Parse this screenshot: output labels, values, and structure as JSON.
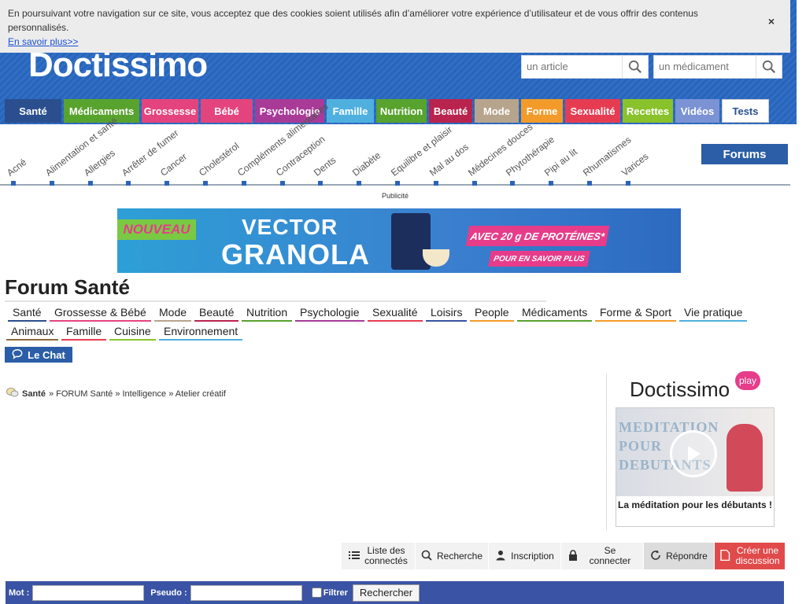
{
  "cookie": {
    "text": "En poursuivant votre navigation sur ce site, vous acceptez que des cookies soient utilisés afin d’améliorer votre expérience d’utilisateur et de vous offrir des contenus personnalisés.",
    "link": "En savoir plus>>",
    "close": "×"
  },
  "header": {
    "logo": "Doctissimo",
    "search_article_placeholder": "un article",
    "search_medicament_placeholder": "un médicament"
  },
  "mainnav": [
    {
      "label": "Santé",
      "color": "#2b4f8e",
      "width": 72
    },
    {
      "label": "Médicaments",
      "color": "#58a32e",
      "width": 96
    },
    {
      "label": "Grossesse",
      "color": "#e4447e",
      "width": 72
    },
    {
      "label": "Bébé",
      "color": "#e4447e",
      "width": 66
    },
    {
      "label": "Psychologie",
      "color": "#a83b98",
      "width": 88
    },
    {
      "label": "Famille",
      "color": "#4fb0e0",
      "width": 60
    },
    {
      "label": "Nutrition",
      "color": "#58a32e",
      "width": 64
    },
    {
      "label": "Beauté",
      "color": "#b8244e",
      "width": 55
    },
    {
      "label": "Mode",
      "color": "#b7a48c",
      "width": 56
    },
    {
      "label": "Forme",
      "color": "#f39b2a",
      "width": 53
    },
    {
      "label": "Sexualité",
      "color": "#e63c52",
      "width": 70
    },
    {
      "label": "Recettes",
      "color": "#8ac22b",
      "width": 64
    },
    {
      "label": "Vidéos",
      "color": "#7b93d4",
      "width": 56
    },
    {
      "label": "Tests",
      "color": "#ffffff",
      "width": 60
    }
  ],
  "subnav": [
    "Acné",
    "Alimentation et santé",
    "Allergies",
    "Arrêter de fumer",
    "Cancer",
    "Cholestérol",
    "Compléments alimentaires",
    "Contraception",
    "Dents",
    "Diabète",
    "Equilibre et plaisir",
    "Mal au dos",
    "Médecines douces",
    "Phytothérapie",
    "Pipi au lit",
    "Rhumatismes",
    "Varices"
  ],
  "forums_label": "Forums",
  "pub_label": "Publicité",
  "banner": {
    "nouveau": "NOUVEAU",
    "brand1": "VECTOR",
    "brand2": "GRANOLA",
    "proteines": "AVEC 20 g DE PROTÉINES*",
    "cta": "POUR EN SAVOIR PLUS"
  },
  "forum_title": "Forum Santé",
  "categories_row1": [
    {
      "label": "Santé",
      "color": "#2b4f8e"
    },
    {
      "label": "Grossesse & Bébé",
      "color": "#e4447e"
    },
    {
      "label": "Mode",
      "color": "#b7a48c"
    },
    {
      "label": "Beauté",
      "color": "#b8244e"
    },
    {
      "label": "Nutrition",
      "color": "#58a32e"
    },
    {
      "label": "Psychologie",
      "color": "#a83b98"
    },
    {
      "label": "Sexualité",
      "color": "#e63c52"
    },
    {
      "label": "Loisirs",
      "color": "#3a53a4"
    },
    {
      "label": "People",
      "color": "#f39b2a"
    },
    {
      "label": "Médicaments",
      "color": "#58a32e"
    },
    {
      "label": "Forme & Sport",
      "color": "#f39b2a"
    },
    {
      "label": "Vie pratique",
      "color": "#4fb0e0"
    }
  ],
  "categories_row2": [
    {
      "label": "Animaux",
      "color": "#8a6a3c"
    },
    {
      "label": "Famille",
      "color": "#e63c52"
    },
    {
      "label": "Cuisine",
      "color": "#8ac22b"
    },
    {
      "label": "Environnement",
      "color": "#4fb0e0"
    }
  ],
  "chat_label": "Le Chat",
  "breadcrumb": {
    "root": "Santé",
    "rest": "» FORUM Santé » Intelligence » Atelier créatif"
  },
  "sidebar": {
    "logo": "Doctissimo",
    "badge": "play",
    "video_title_lines": [
      "MEDITATION",
      "POUR",
      "DEBUTANTS"
    ],
    "caption": "La méditation pour les débutants !"
  },
  "actions": [
    {
      "label": "Liste des connectés",
      "icon": "list-icon"
    },
    {
      "label": "Recherche",
      "icon": "search-icon"
    },
    {
      "label": "Inscription",
      "icon": "user-icon"
    },
    {
      "label": "Se connecter",
      "icon": "lock-icon"
    },
    {
      "label": "Répondre",
      "icon": "reply-icon"
    },
    {
      "label": "Créer une discussion",
      "icon": "document-icon"
    }
  ],
  "searchbar": {
    "mot_label": "Mot :",
    "pseudo_label": "Pseudo :",
    "filtrer_label": "Filtrer",
    "button": "Rechercher"
  }
}
